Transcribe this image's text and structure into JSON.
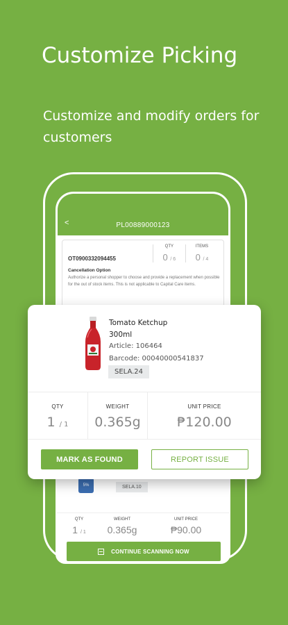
{
  "hero": {
    "title": "Customize Picking",
    "subtitle": "Customize and modify orders for customers"
  },
  "phone": {
    "header_title": "PL00889000123",
    "back_icon": "chevron-left-icon",
    "order": {
      "id": "OT0900332094455",
      "qty_label": "QTY",
      "qty_value": "0",
      "qty_total": "/ 6",
      "items_label": "ITEMS",
      "items_value": "0",
      "items_total": "/ 4",
      "cancel_title": "Cancellation Option",
      "cancel_desc": "Authorize a personal shopper to choose and provide a replacement when possible for the out of stock items. This is not applicable to Capital Care items."
    },
    "lower_item": {
      "thumb_text": "5%",
      "location": "SELA.10",
      "qty_label": "QTY",
      "qty_value": "1",
      "qty_total": "/ 1",
      "weight_label": "WEIGHT",
      "weight_value": "0.365g",
      "price_label": "UNIT PRICE",
      "price_value": "₱90.00"
    },
    "scan_button": "CONTINUE SCANNING NOW"
  },
  "card": {
    "product_name": "Tomato Ketchup",
    "product_size": "300ml",
    "article": "Article: 106464",
    "barcode": "Barcode: 00040000541837",
    "location": "SELA.24",
    "qty_label": "QTY",
    "qty_value": "1",
    "qty_total": "/ 1",
    "weight_label": "WEIGHT",
    "weight_value": "0.365g",
    "price_label": "UNIT PRICE",
    "price_value": "₱120.00",
    "found_button": "MARK AS FOUND",
    "report_button": "REPORT ISSUE"
  },
  "colors": {
    "brand_green": "#76b043",
    "ketchup_red": "#c8232a"
  }
}
